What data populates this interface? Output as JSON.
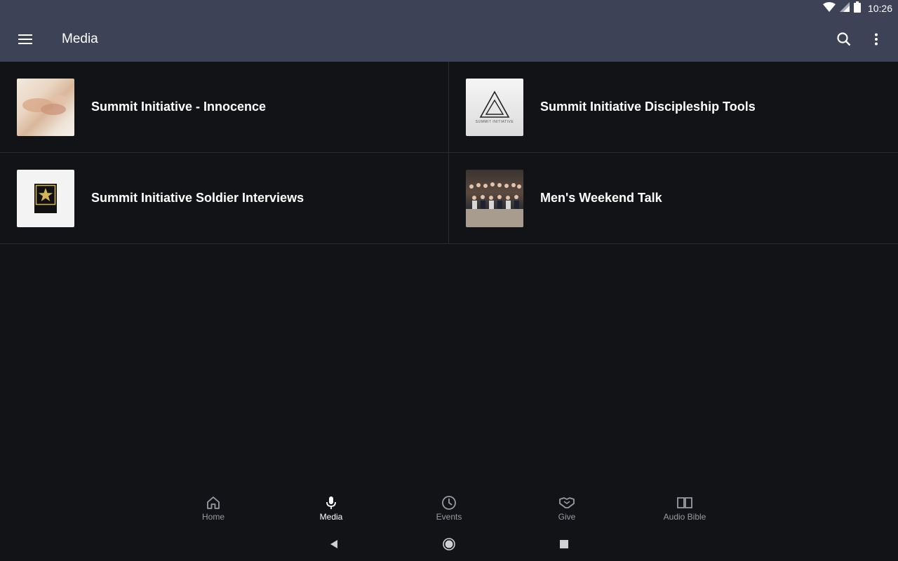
{
  "status_bar": {
    "time": "10:26"
  },
  "app_bar": {
    "title": "Media"
  },
  "media_items": [
    {
      "title": "Summit Initiative - Innocence"
    },
    {
      "title": "Summit Initiative Discipleship Tools",
      "thumb_caption": "SUMMIT INITIATIVE"
    },
    {
      "title": "Summit Initiative Soldier Interviews",
      "thumb_caption": "U.S. ARMY"
    },
    {
      "title": "Men's Weekend Talk"
    }
  ],
  "bottom_nav": [
    {
      "label": "Home",
      "icon": "home-icon"
    },
    {
      "label": "Media",
      "icon": "microphone-icon",
      "active": true
    },
    {
      "label": "Events",
      "icon": "clock-icon"
    },
    {
      "label": "Give",
      "icon": "handshake-icon"
    },
    {
      "label": "Audio Bible",
      "icon": "open-book-icon"
    }
  ],
  "colors": {
    "app_bar": "#3d4257",
    "background": "#121316",
    "divider": "#2a2c31",
    "nav_inactive": "#9a9ca3",
    "nav_active": "#ffffff"
  }
}
